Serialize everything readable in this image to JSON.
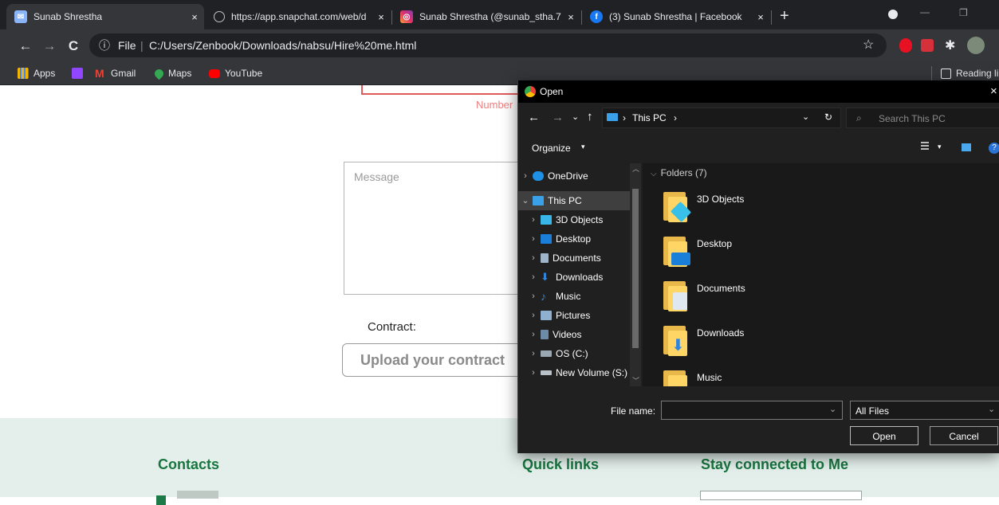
{
  "browser": {
    "tabs": [
      {
        "title": "Sunab Shrestha",
        "close": "×"
      },
      {
        "title": "https://app.snapchat.com/web/d",
        "close": "×"
      },
      {
        "title": "Sunab Shrestha (@sunab_stha.7)",
        "close": "×"
      },
      {
        "title": "(3) Sunab Shrestha | Facebook",
        "close": "×"
      }
    ],
    "new_tab": "+",
    "window_controls": {
      "minimize": "—",
      "restore": "❐"
    },
    "url_scheme": "File",
    "url": "C:/Users/Zenbook/Downloads/nabsu/Hire%20me.html",
    "bookmarks": [
      "Apps",
      "Gmail",
      "Maps",
      "YouTube"
    ],
    "reading_list": "Reading li"
  },
  "page": {
    "number_error": "Number",
    "message_placeholder": "Message",
    "contract_label": "Contract:",
    "upload_button": "Upload your contract",
    "footer": {
      "contacts": "Contacts",
      "quick_links": "Quick links",
      "stay_connected": "Stay connected to Me"
    }
  },
  "dialog": {
    "title": "Open",
    "close": "×",
    "breadcrumb": "This PC",
    "search_placeholder": "Search This PC",
    "organize": "Organize",
    "tree": [
      {
        "label": "OneDrive",
        "color": "#1e90e6"
      },
      {
        "label": "This PC",
        "color": "#3aa0e8"
      },
      {
        "label": "3D Objects",
        "color": "#38b6e8"
      },
      {
        "label": "Desktop",
        "color": "#1a7fd8"
      },
      {
        "label": "Documents",
        "color": "#9fb4c8"
      },
      {
        "label": "Downloads",
        "color": "#2f86e0"
      },
      {
        "label": "Music",
        "color": "#2f86e0"
      },
      {
        "label": "Pictures",
        "color": "#8fb0d0"
      },
      {
        "label": "Videos",
        "color": "#6d8aa6"
      },
      {
        "label": "OS (C:)",
        "color": "#9aa8b4"
      },
      {
        "label": "New Volume (S:)",
        "color": "#b8c0c8"
      }
    ],
    "folders_header": "Folders (7)",
    "folders": [
      {
        "label": "3D Objects",
        "accent": "#38c0e8"
      },
      {
        "label": "Desktop",
        "accent": "#1a7fd8"
      },
      {
        "label": "Documents",
        "accent": "#dfe8f0"
      },
      {
        "label": "Downloads",
        "accent": "#2f86e0"
      },
      {
        "label": "Music",
        "accent": "#2f86e0"
      }
    ],
    "filename_label": "File name:",
    "filename_value": "",
    "filter": "All Files",
    "open_button": "Open",
    "cancel_button": "Cancel"
  }
}
